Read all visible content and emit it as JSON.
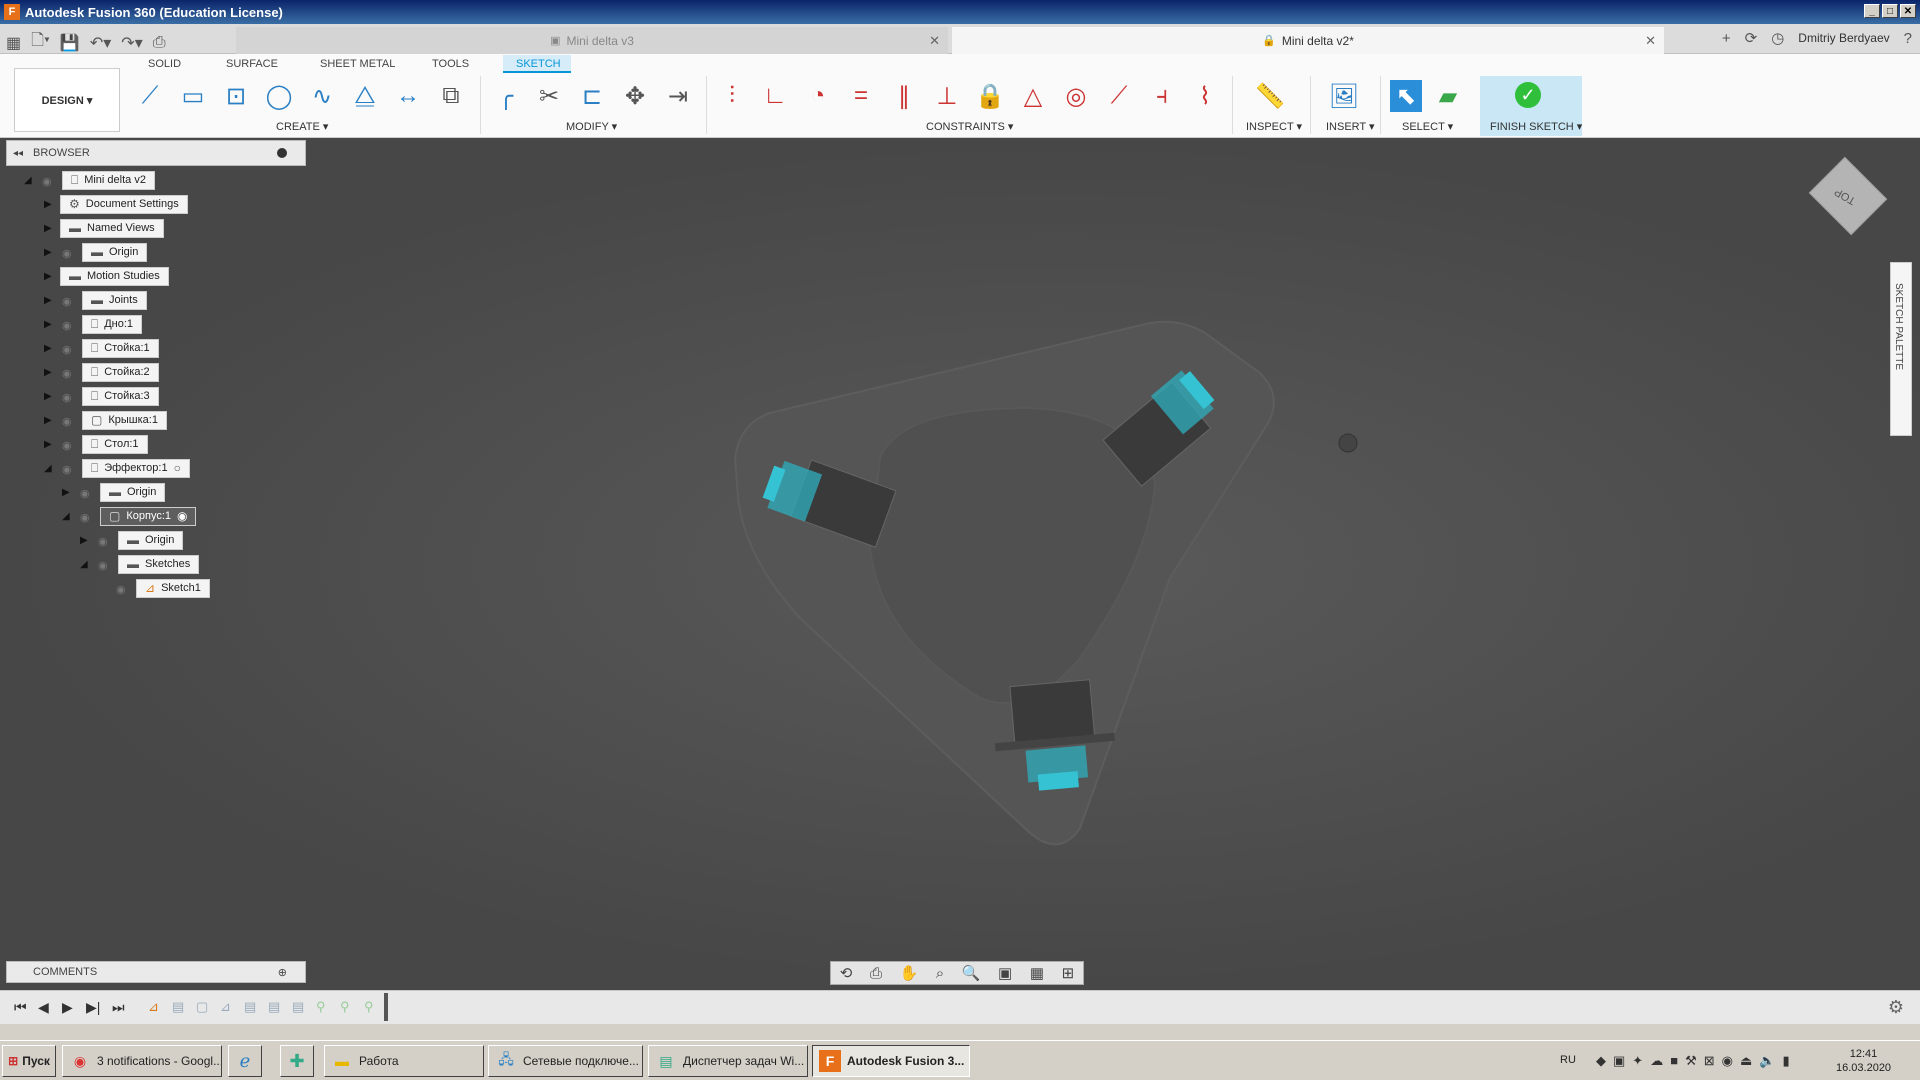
{
  "window": {
    "title": "Autodesk Fusion 360 (Education License)",
    "logo": "F"
  },
  "doc_tabs": [
    {
      "label": "Mini delta v3"
    },
    {
      "label": "Mini delta v2*"
    }
  ],
  "user": {
    "name": "Dmitriy Berdyaev"
  },
  "ribbon": {
    "tabs": [
      "SOLID",
      "SURFACE",
      "SHEET METAL",
      "TOOLS",
      "SKETCH"
    ],
    "active_tab": "SKETCH",
    "workspace": "DESIGN ▾",
    "groups": {
      "create": "CREATE ▾",
      "modify": "MODIFY ▾",
      "constraints": "CONSTRAINTS ▾",
      "inspect": "INSPECT ▾",
      "insert": "INSERT ▾",
      "select": "SELECT ▾",
      "finish": "FINISH SKETCH ▾"
    }
  },
  "browser": {
    "title": "BROWSER",
    "nodes": [
      {
        "label": "Mini delta v2"
      },
      {
        "label": "Document Settings"
      },
      {
        "label": "Named Views"
      },
      {
        "label": "Origin"
      },
      {
        "label": "Motion Studies"
      },
      {
        "label": "Joints"
      },
      {
        "label": "Дно:1"
      },
      {
        "label": "Стойка:1"
      },
      {
        "label": "Стойка:2"
      },
      {
        "label": "Стойка:3"
      },
      {
        "label": "Крышка:1"
      },
      {
        "label": "Стол:1"
      },
      {
        "label": "Эффектор:1"
      },
      {
        "label": "Origin"
      },
      {
        "label": "Корпус:1"
      },
      {
        "label": "Origin"
      },
      {
        "label": "Sketches"
      },
      {
        "label": "Sketch1"
      }
    ]
  },
  "comments": {
    "title": "COMMENTS"
  },
  "viewcube": {
    "label": "TOP"
  },
  "sketch_palette": {
    "label": "SKETCH PALETTE"
  },
  "taskbar": {
    "start": "Пуск",
    "tasks": [
      {
        "label": "3 notifications - Googl..."
      },
      {
        "label": "Работа"
      },
      {
        "label": "Сетевые подключе..."
      },
      {
        "label": "Диспетчер задач Wi..."
      },
      {
        "label": "Autodesk Fusion 3..."
      }
    ],
    "lang": "RU",
    "time": "12:41",
    "date": "16.03.2020"
  },
  "colors": {
    "accent": "#0696d7",
    "finish": "#2fbf3a",
    "model_highlight": "#27b8c8"
  }
}
